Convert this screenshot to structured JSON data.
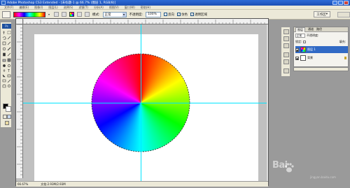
{
  "window": {
    "title": "Adobe Photoshop CS3 Extended - [未标题-1 @ 66.7% (图层 1, RGB/8)]"
  },
  "menu": [
    "文件(F)",
    "编辑(E)",
    "图像(I)",
    "图层(L)",
    "选择(S)",
    "滤镜(T)",
    "分析(A)",
    "视图(V)",
    "窗口(W)",
    "帮助(H)"
  ],
  "options": {
    "mode_label": "模式:",
    "mode_value": "正常",
    "opacity_label": "不透明度:",
    "opacity_value": "100%",
    "reverse_label": "反向",
    "dither_label": "仿色",
    "transparency_label": "透明区域",
    "workspace_label": "工作区"
  },
  "document": {
    "zoom": "66.67%",
    "doc_info": "文档:2.93M/2.93M",
    "guides": true
  },
  "panels": {
    "tabs": [
      "图层",
      "通道",
      "路径"
    ],
    "blend_mode": "正常",
    "opacity_label": "不透明度:",
    "lock_label": "锁定:",
    "fill_label": "填充:",
    "layers": [
      {
        "name": "图层 1",
        "selected": true
      },
      {
        "name": "背景",
        "selected": false
      }
    ]
  },
  "watermark": {
    "text": "Bai",
    "subtext": "jingyan.baidu.com"
  },
  "colors": {
    "foreground": "#000000",
    "background": "#ffffff",
    "selection": "#316ac5",
    "guide": "#00e5ff"
  }
}
